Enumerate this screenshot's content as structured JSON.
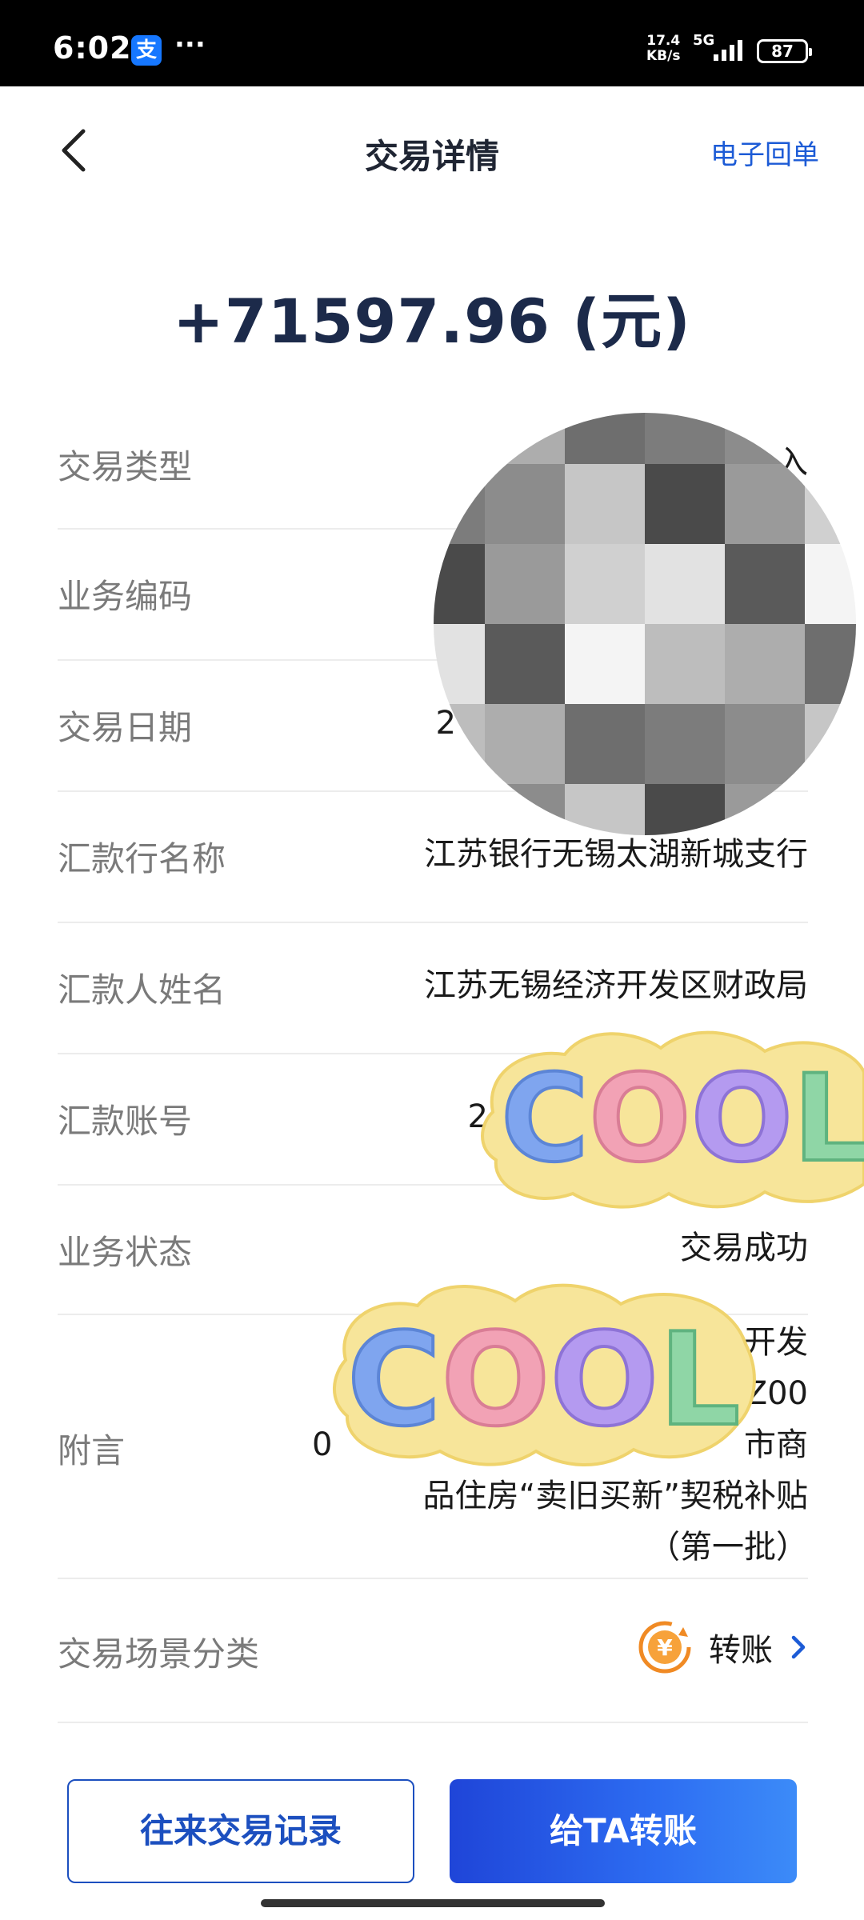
{
  "status_bar": {
    "time": "6:02",
    "app_badge": "支",
    "dots": "···",
    "net_speed_value": "17.4",
    "net_speed_unit": "KB/s",
    "net_type": "5G",
    "battery": "87"
  },
  "nav": {
    "title": "交易详情",
    "action": "电子回单"
  },
  "amount": "+71597.96 (元)",
  "details": [
    {
      "label": "交易类型",
      "value": "入"
    },
    {
      "label": "业务编码",
      "value": ""
    },
    {
      "label": "交易日期",
      "value": "2"
    },
    {
      "label": "汇款行名称",
      "value": "江苏银行无锡太湖新城支行"
    },
    {
      "label": "汇款人姓名",
      "value": "江苏无锡经济开发区财政局"
    },
    {
      "label": "汇款账号",
      "value": "2"
    },
    {
      "label": "业务状态",
      "value": "交易成功"
    },
    {
      "label": "附言",
      "value_lines": [
        "开发",
        "Z00",
        "0",
        "市商",
        "品住房“卖旧买新”契税补贴",
        "（第一批）"
      ]
    },
    {
      "label": "交易场景分类",
      "value": "转账"
    }
  ],
  "sticker_text": "COOL",
  "buttons": {
    "secondary": "往来交易记录",
    "primary": "给TA转账"
  },
  "colors": {
    "accent": "#1c5bd6",
    "amount": "#1c2a4a",
    "primary_button": "#2d6df2",
    "sticker_bg": "#f7e59a"
  }
}
